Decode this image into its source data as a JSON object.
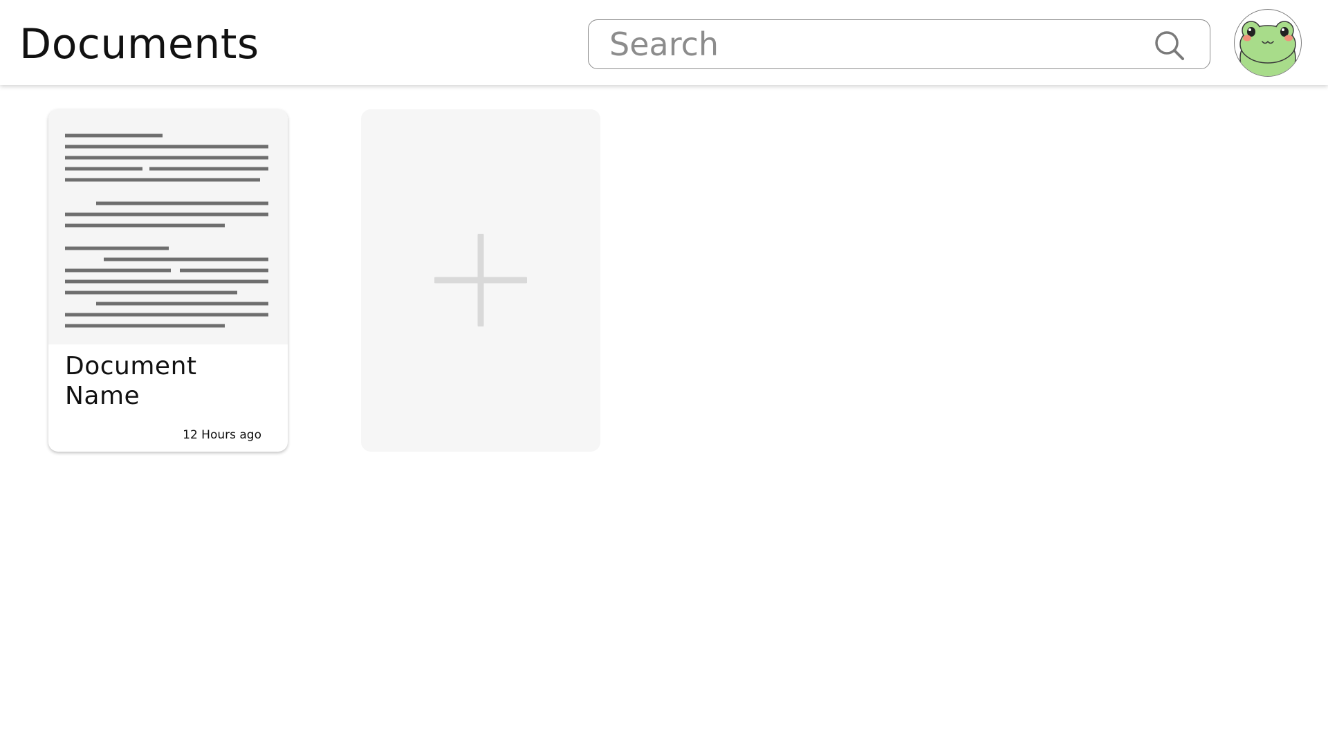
{
  "header": {
    "title": "Documents",
    "search": {
      "placeholder": "Search",
      "value": "",
      "icon": "search-icon"
    },
    "avatar": {
      "icon": "frog-avatar"
    }
  },
  "documents": [
    {
      "name": "Document Name",
      "modified": "12 Hours ago"
    }
  ],
  "new_document": {
    "icon": "plus-icon"
  },
  "colors": {
    "background": "#ffffff",
    "card_preview_bg": "#f5f5f5",
    "new_card_bg": "#f6f6f6",
    "preview_lines": "#6e6e6e",
    "plus": "#d9d9d9",
    "frog_green": "#a8dc8a"
  }
}
